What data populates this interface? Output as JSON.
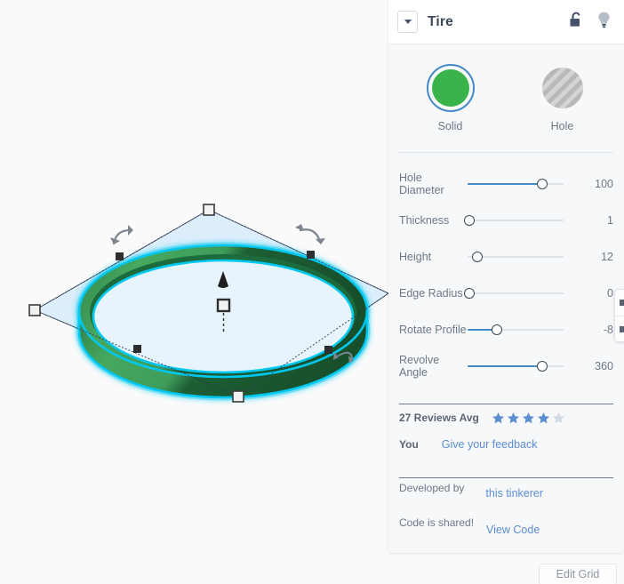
{
  "panel": {
    "title": "Tire",
    "header_icons": [
      {
        "name": "unlock-icon",
        "label": "Unlocked"
      },
      {
        "name": "lightbulb-icon",
        "label": "Visible"
      }
    ],
    "dropdown_caret": "chevron-down-icon",
    "shapes": [
      {
        "id": "solid",
        "label": "Solid",
        "selected": true,
        "color": "#3ab34a"
      },
      {
        "id": "hole",
        "label": "Hole",
        "selected": false,
        "color": "#c4c4c4"
      }
    ],
    "sliders": [
      {
        "id": "hole-diameter",
        "label": "Hole Diameter",
        "value": "100",
        "fill_pct": 88
      },
      {
        "id": "thickness",
        "label": "Thickness",
        "value": "1",
        "fill_pct": 0
      },
      {
        "id": "height",
        "label": "Height",
        "value": "12",
        "fill_pct": 9
      },
      {
        "id": "edge-radius",
        "label": "Edge Radius",
        "value": "0",
        "fill_pct": 0
      },
      {
        "id": "rotate-profile",
        "label": "Rotate Profile",
        "value": "-8",
        "fill_pct": 38
      },
      {
        "id": "revolve-angle",
        "label": "Revolve Angle",
        "value": "360",
        "fill_pct": 88
      }
    ],
    "reviews": {
      "count_label": "27 Reviews Avg",
      "stars_filled": 4,
      "stars_total": 5,
      "you_label": "You",
      "feedback_link": "Give your feedback"
    },
    "developed": {
      "label": "Developed by",
      "link": "this tinkerer"
    },
    "code": {
      "label": "Code is shared!",
      "link": "View Code"
    }
  },
  "canvas": {
    "object_name": "Tire",
    "selection_color": "#00c8f0",
    "body_color_light": "#3f9d5b",
    "body_color_dark": "#1d5e33",
    "workplane_color": "#dceefb",
    "handles": [
      {
        "name": "corner-handle-top"
      },
      {
        "name": "corner-handle-left"
      },
      {
        "name": "corner-handle-bottom"
      },
      {
        "name": "edge-handle-upper-left"
      },
      {
        "name": "edge-handle-upper-right"
      },
      {
        "name": "edge-handle-lower-left"
      },
      {
        "name": "edge-handle-lower-right"
      },
      {
        "name": "height-cone-handle"
      },
      {
        "name": "center-square-handle"
      },
      {
        "name": "rotate-arrow-left"
      },
      {
        "name": "rotate-arrow-right"
      },
      {
        "name": "rotate-arrow-bottom"
      }
    ]
  },
  "toolbar_edge": {
    "name": "floating-toolbar"
  },
  "edit_grid_button": {
    "label": "Edit Grid"
  }
}
